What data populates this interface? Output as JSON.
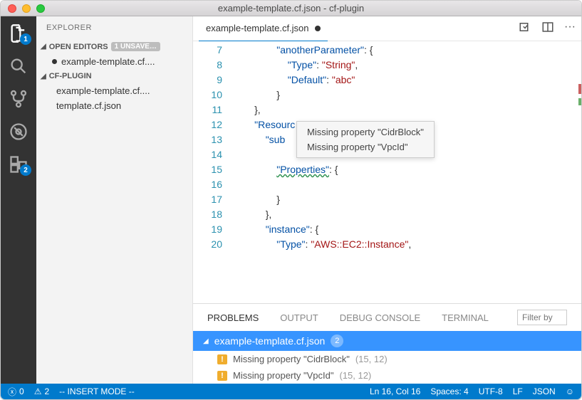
{
  "titlebar": {
    "title": "example-template.cf.json - cf-plugin"
  },
  "activity": {
    "explorer_badge": "1",
    "extensions_badge": "2"
  },
  "sidebar": {
    "title": "EXPLORER",
    "open_editors_label": "OPEN EDITORS",
    "unsaved_label": "1 UNSAVE…",
    "open_file": "example-template.cf....",
    "workspace_label": "CF-PLUGIN",
    "files": [
      "example-template.cf....",
      "template.cf.json"
    ]
  },
  "tab": {
    "name": "example-template.cf.json"
  },
  "code": {
    "lines": [
      {
        "n": 7,
        "indent": "                ",
        "tokens": [
          [
            "key",
            "\"anotherParameter\""
          ],
          [
            "brc",
            ": {"
          ]
        ]
      },
      {
        "n": 8,
        "indent": "                    ",
        "tokens": [
          [
            "key",
            "\"Type\""
          ],
          [
            "brc",
            ": "
          ],
          [
            "str",
            "\"String\""
          ],
          [
            "brc",
            ","
          ]
        ]
      },
      {
        "n": 9,
        "indent": "                    ",
        "tokens": [
          [
            "key",
            "\"Default\""
          ],
          [
            "brc",
            ": "
          ],
          [
            "str",
            "\"abc\""
          ]
        ]
      },
      {
        "n": 10,
        "indent": "                ",
        "tokens": [
          [
            "brc",
            "}"
          ]
        ]
      },
      {
        "n": 11,
        "indent": "        ",
        "tokens": [
          [
            "brc",
            "},"
          ]
        ]
      },
      {
        "n": 12,
        "indent": "        ",
        "tokens": [
          [
            "key",
            "\"Resourc"
          ]
        ]
      },
      {
        "n": 13,
        "indent": "            ",
        "tokens": [
          [
            "key",
            "\"sub"
          ]
        ]
      },
      {
        "n": 14,
        "indent": "",
        "tokens": []
      },
      {
        "n": 15,
        "indent": "                ",
        "tokens": [
          [
            "key squig",
            "\"Properties\""
          ],
          [
            "brc",
            ": {"
          ]
        ]
      },
      {
        "n": 16,
        "indent": "",
        "tokens": []
      },
      {
        "n": 17,
        "indent": "                ",
        "tokens": [
          [
            "brc",
            "}"
          ]
        ]
      },
      {
        "n": 18,
        "indent": "            ",
        "tokens": [
          [
            "brc",
            "},"
          ]
        ]
      },
      {
        "n": 19,
        "indent": "            ",
        "tokens": [
          [
            "key",
            "\"instance\""
          ],
          [
            "brc",
            ": {"
          ]
        ]
      },
      {
        "n": 20,
        "indent": "                ",
        "tokens": [
          [
            "key",
            "\"Type\""
          ],
          [
            "brc",
            ": "
          ],
          [
            "str",
            "\"AWS::EC2::Instance\""
          ],
          [
            "brc",
            ","
          ]
        ]
      }
    ]
  },
  "tooltip": {
    "line1": "Missing property \"CidrBlock\"",
    "line2": "Missing property \"VpcId\""
  },
  "panel": {
    "tabs": {
      "problems": "PROBLEMS",
      "output": "OUTPUT",
      "debug": "DEBUG CONSOLE",
      "terminal": "TERMINAL"
    },
    "filter_placeholder": "Filter by",
    "file": "example-template.cf.json",
    "file_count": "2",
    "items": [
      {
        "msg": "Missing property \"CidrBlock\"",
        "loc": "(15, 12)"
      },
      {
        "msg": "Missing property \"VpcId\"",
        "loc": "(15, 12)"
      }
    ]
  },
  "status": {
    "errors": "0",
    "warnings": "2",
    "mode": "-- INSERT MODE --",
    "position": "Ln 16, Col 16",
    "spaces": "Spaces: 4",
    "encoding": "UTF-8",
    "eol": "LF",
    "lang": "JSON"
  }
}
